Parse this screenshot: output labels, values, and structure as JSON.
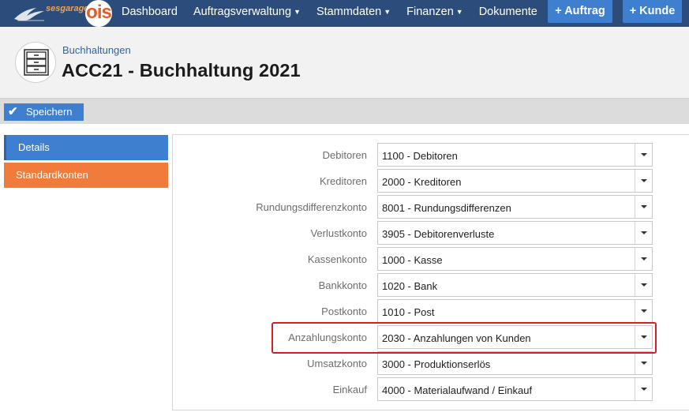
{
  "nav": {
    "logo_text": "sesgarage",
    "logo_mark": "ois",
    "items": [
      {
        "label": "Dashboard",
        "dropdown": false
      },
      {
        "label": "Auftragsverwaltung",
        "dropdown": true
      },
      {
        "label": "Stammdaten",
        "dropdown": true
      },
      {
        "label": "Finanzen",
        "dropdown": true
      },
      {
        "label": "Dokumente",
        "dropdown": false
      }
    ],
    "btn_auftrag": "+ Auftrag",
    "btn_kunde": "+ Kunde"
  },
  "header": {
    "breadcrumb": "Buchhaltungen",
    "title": "ACC21 - Buchhaltung 2021",
    "icon": "file-cabinet-icon"
  },
  "toolbar": {
    "save_label": "Speichern"
  },
  "tabs": [
    {
      "label": "Details"
    },
    {
      "label": "Standardkonten"
    }
  ],
  "form": {
    "rows": [
      {
        "label": "Debitoren",
        "value": "1100 - Debitoren"
      },
      {
        "label": "Kreditoren",
        "value": "2000 - Kreditoren"
      },
      {
        "label": "Rundungsdifferenzkonto",
        "value": "8001 - Rundungsdifferenzen"
      },
      {
        "label": "Verlustkonto",
        "value": "3905 - Debitorenverluste"
      },
      {
        "label": "Kassenkonto",
        "value": "1000 - Kasse"
      },
      {
        "label": "Bankkonto",
        "value": "1020 - Bank"
      },
      {
        "label": "Postkonto",
        "value": "1010 - Post"
      },
      {
        "label": "Anzahlungskonto",
        "value": "2030 - Anzahlungen von Kunden"
      },
      {
        "label": "Umsatzkonto",
        "value": "3000 - Produktionserlös"
      },
      {
        "label": "Einkauf",
        "value": "4000 - Materialaufwand / Einkauf"
      }
    ]
  },
  "colors": {
    "navbar": "#2c4d7c",
    "accent_blue": "#3f7fd0",
    "accent_orange": "#f07b3a",
    "highlight_red": "#d41f2b"
  }
}
